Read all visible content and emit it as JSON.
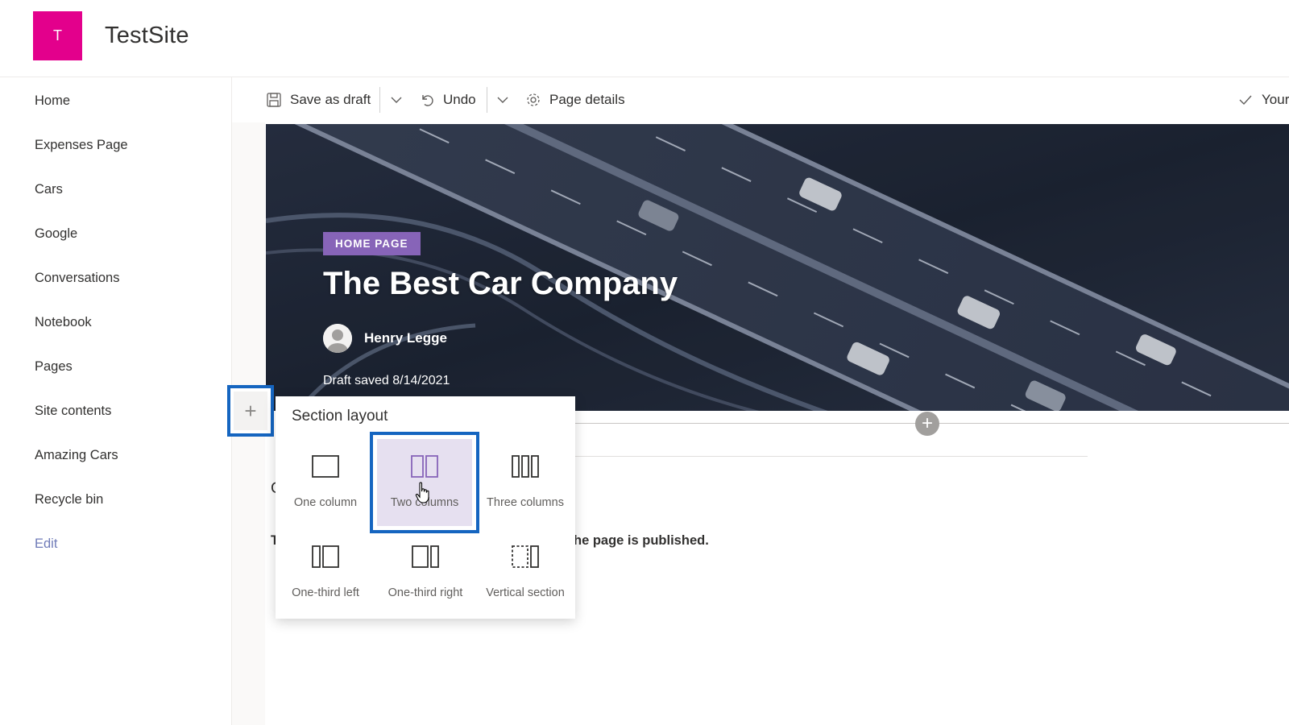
{
  "site": {
    "logo_letter": "T",
    "title": "TestSite",
    "logo_color": "#e3008c"
  },
  "nav": {
    "items": [
      "Home",
      "Expenses Page",
      "Cars",
      "Google",
      "Conversations",
      "Notebook",
      "Pages",
      "Site contents",
      "Amazing Cars",
      "Recycle bin"
    ],
    "edit_label": "Edit"
  },
  "toolbar": {
    "save_label": "Save as draft",
    "undo_label": "Undo",
    "page_details_label": "Page details",
    "right_label": "Your"
  },
  "hero": {
    "tag": "HOME PAGE",
    "title": "The Best Car Company",
    "author": "Henry Legge",
    "draft_status": "Draft saved 8/14/2021"
  },
  "body": {
    "partial_text_1": "C",
    "partial_text_2": "T",
    "partial_text_3": "he page is published."
  },
  "section_layout": {
    "title": "Section layout",
    "options": [
      {
        "label": "One column",
        "icon": "one-column-icon"
      },
      {
        "label": "Two columns",
        "icon": "two-columns-icon",
        "selected": true
      },
      {
        "label": "Three columns",
        "icon": "three-columns-icon"
      },
      {
        "label": "One-third left",
        "icon": "one-third-left-icon"
      },
      {
        "label": "One-third right",
        "icon": "one-third-right-icon"
      },
      {
        "label": "Vertical section",
        "icon": "vertical-section-icon"
      }
    ],
    "accent": "#8764b8",
    "highlight_border": "#1565c0"
  }
}
